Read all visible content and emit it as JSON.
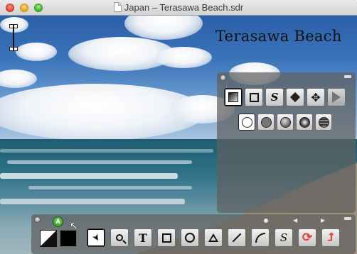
{
  "window": {
    "title": "Japan – Terasawa Beach.sdr"
  },
  "photo": {
    "caption": "Terasawa Beach"
  },
  "shape_palette": {
    "tools": [
      {
        "name": "gradient-fill-icon",
        "selected": true
      },
      {
        "name": "rectangle-icon",
        "selected": false
      },
      {
        "name": "freehand-icon",
        "label": "S",
        "selected": false
      },
      {
        "name": "diamond-icon",
        "selected": false
      },
      {
        "name": "move-icon",
        "label": "✥",
        "selected": false
      },
      {
        "name": "play-icon",
        "selected": false
      }
    ],
    "fills": [
      {
        "name": "white-fill-icon",
        "color": "#ffffff",
        "selected": true
      },
      {
        "name": "gray-fill-icon",
        "color": "#7a7a7a",
        "selected": false
      },
      {
        "name": "shaded-fill-icon",
        "color": "#555555",
        "selected": false
      },
      {
        "name": "radial-fill-icon",
        "color": "#333333",
        "selected": false
      },
      {
        "name": "globe-fill-icon",
        "color": "#444444",
        "selected": false
      }
    ]
  },
  "tool_palette": {
    "layer_badge": "A",
    "nav_left": "◀",
    "nav_right": "▶",
    "colors": {
      "foreground": "#ffffff",
      "background": "#000000"
    },
    "tools": [
      {
        "name": "arrow-tool",
        "label": "➤",
        "selected": true
      },
      {
        "name": "zoom-tool",
        "label": "🔍",
        "selected": false
      },
      {
        "name": "text-tool",
        "label": "T",
        "selected": false
      },
      {
        "name": "rectangle-tool",
        "selected": false
      },
      {
        "name": "ellipse-tool",
        "selected": false
      },
      {
        "name": "triangle-tool",
        "selected": false
      },
      {
        "name": "line-tool",
        "selected": false
      },
      {
        "name": "arc-tool",
        "selected": false
      },
      {
        "name": "freehand-tool",
        "label": "S",
        "selected": false
      },
      {
        "name": "rotate-tool",
        "label": "⟳",
        "selected": false
      },
      {
        "name": "flip-tool",
        "label": "⮥",
        "selected": false
      }
    ]
  },
  "colors": {
    "accent_red": "#e0443c",
    "badge_green": "#3fae2e"
  }
}
